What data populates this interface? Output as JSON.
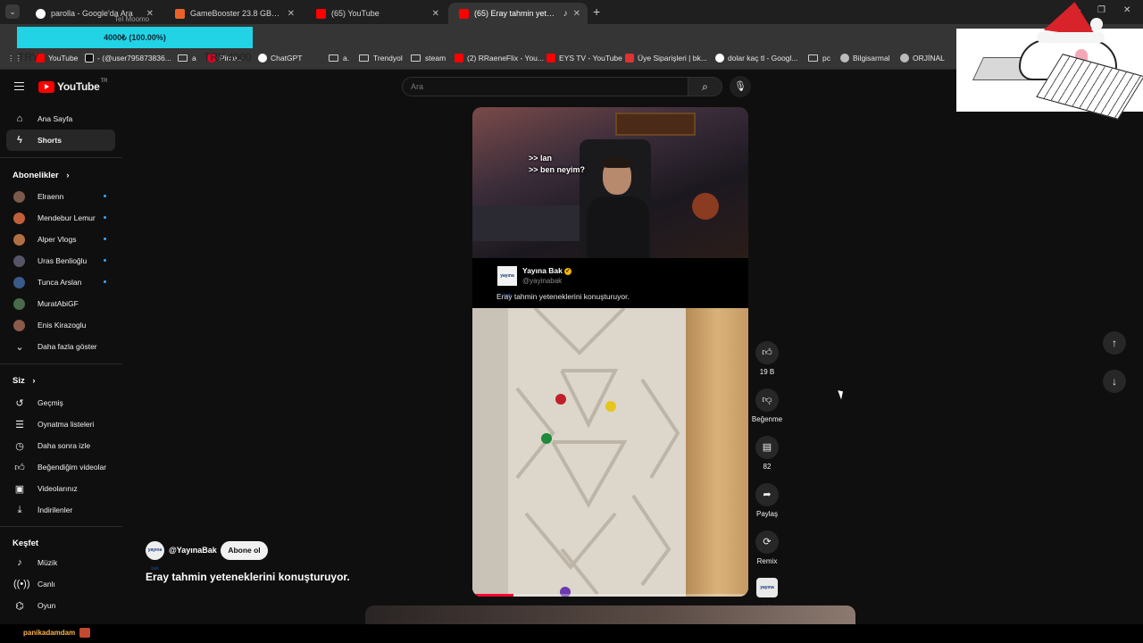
{
  "browser": {
    "tabs": [
      {
        "title": "parolla - Google'da Ara",
        "favicon_color": "#ffffff"
      },
      {
        "title": "GameBooster 23.8 GB-2420FF",
        "favicon_color": "#e8632b"
      },
      {
        "title": "(65) YouTube",
        "favicon_color": "#ff0000"
      },
      {
        "title": "(65) Eray tahmin yetenekleri",
        "favicon_color": "#ff0000",
        "active": true
      }
    ],
    "bookmarks": [
      {
        "label": "YouTube",
        "icon": "youtube-icon"
      },
      {
        "label": "- (@user795873836...",
        "icon": "tiktok-icon"
      },
      {
        "label": "a",
        "icon": "folder-icon"
      },
      {
        "label": "Pinte...",
        "icon": "pinterest-icon"
      },
      {
        "label": "ChatGPT",
        "icon": "chatgpt-icon"
      },
      {
        "label": "a.",
        "icon": "folder-icon"
      },
      {
        "label": "Trendyol",
        "icon": "folder-icon"
      },
      {
        "label": "steam",
        "icon": "folder-icon"
      },
      {
        "label": "(2) RRaeneFlix - You...",
        "icon": "youtube-icon"
      },
      {
        "label": "EYS TV - YouTube",
        "icon": "youtube-icon"
      },
      {
        "label": "Üye Siparişleri | bk...",
        "icon": "shop-icon"
      },
      {
        "label": "dolar kaç tl - Googl...",
        "icon": "google-icon"
      },
      {
        "label": "pc",
        "icon": "folder-icon"
      },
      {
        "label": "Bilgisarmal",
        "icon": "globe-icon"
      },
      {
        "label": "ORJİNAL",
        "icon": "globe-icon"
      }
    ]
  },
  "overlay": {
    "progress_text": "4000₺ (100.00%)",
    "progress_fraction": 1.0,
    "bar_label": "TRY 4000",
    "bar_prefix": "TRY",
    "donor_text": "Tel Moomo"
  },
  "youtube": {
    "logo_text": "YouTube",
    "logo_region": "TR",
    "search_placeholder": "Ara",
    "nav": {
      "home": "Ana Sayfa",
      "shorts": "Shorts"
    },
    "subscriptions_title": "Abonelikler",
    "subscriptions": [
      {
        "name": "Elraenn",
        "color": "#7a5a4a"
      },
      {
        "name": "Mendebur Lemur",
        "color": "#c0603a"
      },
      {
        "name": "Alper Vlogs",
        "color": "#b07044"
      },
      {
        "name": "Uras Benlioğlu",
        "color": "#555566"
      },
      {
        "name": "Tunca Arslan",
        "color": "#3a5a8a"
      },
      {
        "name": "MuratAbiGF",
        "color": "#4a6a4a"
      },
      {
        "name": "Enis Kirazoglu",
        "color": "#8a5a4a"
      }
    ],
    "show_more": "Daha fazla göster",
    "you_title": "Siz",
    "you_items": [
      {
        "label": "Geçmiş",
        "icon": "history-icon"
      },
      {
        "label": "Oynatma listeleri",
        "icon": "playlist-icon"
      },
      {
        "label": "Daha sonra izle",
        "icon": "clock-icon"
      },
      {
        "label": "Beğendiğim videolar",
        "icon": "like-icon"
      },
      {
        "label": "Videolarınız",
        "icon": "video-icon"
      },
      {
        "label": "İndirilenler",
        "icon": "download-icon"
      }
    ],
    "explore_title": "Keşfet",
    "explore_items": [
      {
        "label": "Müzik",
        "icon": "music-icon"
      },
      {
        "label": "Canlı",
        "icon": "live-icon"
      },
      {
        "label": "Oyun",
        "icon": "game-icon"
      }
    ],
    "short": {
      "caption_text": ">> lan\n>> ben neyim?",
      "tweet_name": "Yayına Bak",
      "tweet_handle": "@yayinabak",
      "tweet_text": "Eray tahmin yeteneklerini konuşturuyor.",
      "logo_text": "yayına bak",
      "progress_fraction": 0.15
    },
    "actions": {
      "like_label": "19 B",
      "dislike_label": "Beğenme",
      "comments_label": "82",
      "share_label": "Paylaş",
      "remix_label": "Remix"
    },
    "channel": {
      "handle": "@YayınaBak",
      "subscribe": "Abone ol",
      "avatar_text": "yayına bak"
    },
    "title": "Eray tahmin yeteneklerini konuşturuyor."
  },
  "taskbar": {
    "text": "panikadamdam"
  }
}
